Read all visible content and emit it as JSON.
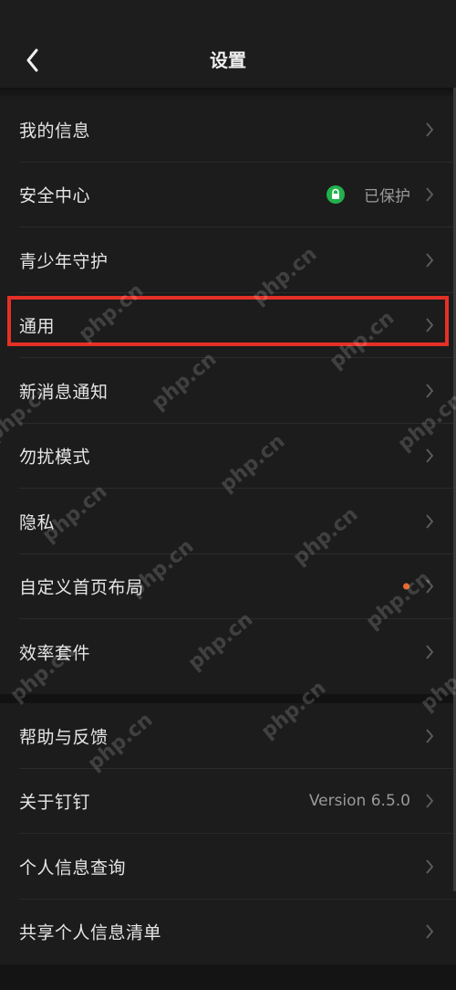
{
  "header": {
    "title": "设置",
    "back_icon": "chevron-left-icon"
  },
  "groups": [
    {
      "items": [
        {
          "label": "我的信息"
        },
        {
          "label": "安全中心",
          "value": "已保护",
          "icon": "shield-lock-icon",
          "icon_color": "#22b14c"
        },
        {
          "label": "青少年守护"
        },
        {
          "label": "通用",
          "highlighted": true
        },
        {
          "label": "新消息通知"
        },
        {
          "label": "勿扰模式"
        },
        {
          "label": "隐私"
        },
        {
          "label": "自定义首页布局",
          "badge": "dot",
          "badge_color": "#e86a2c"
        },
        {
          "label": "效率套件"
        }
      ]
    },
    {
      "items": [
        {
          "label": "帮助与反馈"
        },
        {
          "label": "关于钉钉",
          "value": "Version 6.5.0"
        },
        {
          "label": "个人信息查询"
        },
        {
          "label": "共享个人信息清单"
        }
      ]
    }
  ],
  "highlight_color": "#e53026",
  "watermark_text": "php.cn"
}
